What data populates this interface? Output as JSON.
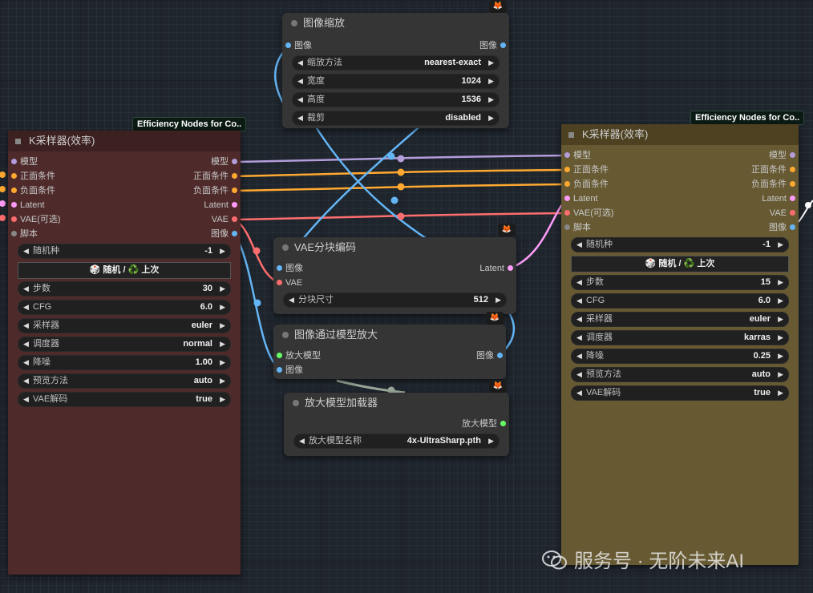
{
  "nodes": {
    "image_scale": {
      "title": "图像缩放",
      "input": "图像",
      "output": "图像",
      "widgets": [
        {
          "label": "缩放方法",
          "value": "nearest-exact"
        },
        {
          "label": "宽度",
          "value": "1024"
        },
        {
          "label": "高度",
          "value": "1536"
        },
        {
          "label": "裁剪",
          "value": "disabled"
        }
      ]
    },
    "ksampler_left": {
      "badge": "Efficiency Nodes for Co..",
      "title": "K采样器(效率)",
      "inputs": [
        "模型",
        "正面条件",
        "负面条件",
        "Latent",
        "VAE(可选)",
        "脚本"
      ],
      "outputs": [
        "模型",
        "正面条件",
        "负面条件",
        "Latent",
        "VAE",
        "图像"
      ],
      "seed": {
        "label": "随机种",
        "value": "-1"
      },
      "seed_button": "🎲 随机 / ♻️ 上次",
      "widgets": [
        {
          "label": "步数",
          "value": "30"
        },
        {
          "label": "CFG",
          "value": "6.0"
        },
        {
          "label": "采样器",
          "value": "euler"
        },
        {
          "label": "调度器",
          "value": "normal"
        },
        {
          "label": "降噪",
          "value": "1.00"
        },
        {
          "label": "预览方法",
          "value": "auto"
        },
        {
          "label": "VAE解码",
          "value": "true"
        }
      ]
    },
    "ksampler_right": {
      "badge": "Efficiency Nodes for Co..",
      "title": "K采样器(效率)",
      "inputs": [
        "模型",
        "正面条件",
        "负面条件",
        "Latent",
        "VAE(可选)",
        "脚本"
      ],
      "outputs": [
        "模型",
        "正面条件",
        "负面条件",
        "Latent",
        "VAE",
        "图像"
      ],
      "seed": {
        "label": "随机种",
        "value": "-1"
      },
      "seed_button": "🎲 随机 / ♻️ 上次",
      "widgets": [
        {
          "label": "步数",
          "value": "15"
        },
        {
          "label": "CFG",
          "value": "6.0"
        },
        {
          "label": "采样器",
          "value": "euler"
        },
        {
          "label": "调度器",
          "value": "karras"
        },
        {
          "label": "降噪",
          "value": "0.25"
        },
        {
          "label": "预览方法",
          "value": "auto"
        },
        {
          "label": "VAE解码",
          "value": "true"
        }
      ]
    },
    "vae_tiled": {
      "title": "VAE分块编码",
      "inputs": [
        "图像",
        "VAE"
      ],
      "output": "Latent",
      "widgets": [
        {
          "label": "分块尺寸",
          "value": "512"
        }
      ]
    },
    "upscale_with_model": {
      "title": "图像通过模型放大",
      "inputs": [
        "放大模型",
        "图像"
      ],
      "output": "图像"
    },
    "upscale_loader": {
      "title": "放大模型加载器",
      "output": "放大模型",
      "widgets": [
        {
          "label": "放大模型名称",
          "value": "4x-UltraSharp.pth"
        }
      ]
    }
  },
  "watermark": "服务号 · 无阶未来AI",
  "colors": {
    "model": "#b39ddb",
    "conditioning": "#ffa931",
    "latent": "#ff9cf9",
    "vae": "#ff6e6e",
    "image": "#64b5f6",
    "script": "#888888",
    "upscale_model": "#66ff66",
    "canvas": "#1e252d"
  },
  "icons": {
    "fox": "fox-icon",
    "arrow_left": "arrow-left-icon",
    "arrow_right": "arrow-right-icon",
    "wechat": "wechat-icon"
  }
}
